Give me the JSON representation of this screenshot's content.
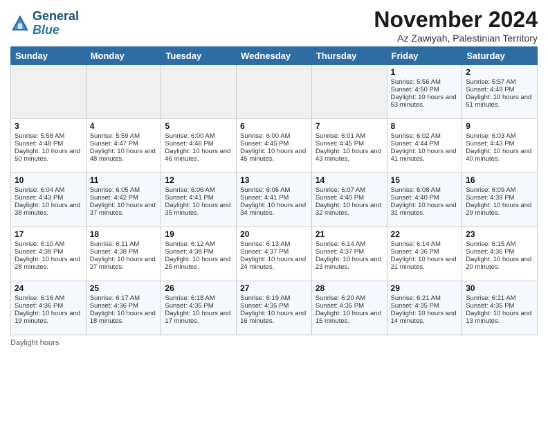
{
  "header": {
    "logo_line1": "General",
    "logo_line2": "Blue",
    "title": "November 2024",
    "subtitle": "Az Zawiyah, Palestinian Territory"
  },
  "days_of_week": [
    "Sunday",
    "Monday",
    "Tuesday",
    "Wednesday",
    "Thursday",
    "Friday",
    "Saturday"
  ],
  "weeks": [
    [
      {
        "day": "",
        "info": ""
      },
      {
        "day": "",
        "info": ""
      },
      {
        "day": "",
        "info": ""
      },
      {
        "day": "",
        "info": ""
      },
      {
        "day": "",
        "info": ""
      },
      {
        "day": "1",
        "info": "Sunrise: 5:56 AM\nSunset: 4:50 PM\nDaylight: 10 hours and 53 minutes."
      },
      {
        "day": "2",
        "info": "Sunrise: 5:57 AM\nSunset: 4:49 PM\nDaylight: 10 hours and 51 minutes."
      }
    ],
    [
      {
        "day": "3",
        "info": "Sunrise: 5:58 AM\nSunset: 4:48 PM\nDaylight: 10 hours and 50 minutes."
      },
      {
        "day": "4",
        "info": "Sunrise: 5:59 AM\nSunset: 4:47 PM\nDaylight: 10 hours and 48 minutes."
      },
      {
        "day": "5",
        "info": "Sunrise: 6:00 AM\nSunset: 4:46 PM\nDaylight: 10 hours and 46 minutes."
      },
      {
        "day": "6",
        "info": "Sunrise: 6:00 AM\nSunset: 4:45 PM\nDaylight: 10 hours and 45 minutes."
      },
      {
        "day": "7",
        "info": "Sunrise: 6:01 AM\nSunset: 4:45 PM\nDaylight: 10 hours and 43 minutes."
      },
      {
        "day": "8",
        "info": "Sunrise: 6:02 AM\nSunset: 4:44 PM\nDaylight: 10 hours and 41 minutes."
      },
      {
        "day": "9",
        "info": "Sunrise: 6:03 AM\nSunset: 4:43 PM\nDaylight: 10 hours and 40 minutes."
      }
    ],
    [
      {
        "day": "10",
        "info": "Sunrise: 6:04 AM\nSunset: 4:43 PM\nDaylight: 10 hours and 38 minutes."
      },
      {
        "day": "11",
        "info": "Sunrise: 6:05 AM\nSunset: 4:42 PM\nDaylight: 10 hours and 37 minutes."
      },
      {
        "day": "12",
        "info": "Sunrise: 6:06 AM\nSunset: 4:41 PM\nDaylight: 10 hours and 35 minutes."
      },
      {
        "day": "13",
        "info": "Sunrise: 6:06 AM\nSunset: 4:41 PM\nDaylight: 10 hours and 34 minutes."
      },
      {
        "day": "14",
        "info": "Sunrise: 6:07 AM\nSunset: 4:40 PM\nDaylight: 10 hours and 32 minutes."
      },
      {
        "day": "15",
        "info": "Sunrise: 6:08 AM\nSunset: 4:40 PM\nDaylight: 10 hours and 31 minutes."
      },
      {
        "day": "16",
        "info": "Sunrise: 6:09 AM\nSunset: 4:39 PM\nDaylight: 10 hours and 29 minutes."
      }
    ],
    [
      {
        "day": "17",
        "info": "Sunrise: 6:10 AM\nSunset: 4:38 PM\nDaylight: 10 hours and 28 minutes."
      },
      {
        "day": "18",
        "info": "Sunrise: 6:11 AM\nSunset: 4:38 PM\nDaylight: 10 hours and 27 minutes."
      },
      {
        "day": "19",
        "info": "Sunrise: 6:12 AM\nSunset: 4:38 PM\nDaylight: 10 hours and 25 minutes."
      },
      {
        "day": "20",
        "info": "Sunrise: 6:13 AM\nSunset: 4:37 PM\nDaylight: 10 hours and 24 minutes."
      },
      {
        "day": "21",
        "info": "Sunrise: 6:14 AM\nSunset: 4:37 PM\nDaylight: 10 hours and 23 minutes."
      },
      {
        "day": "22",
        "info": "Sunrise: 6:14 AM\nSunset: 4:36 PM\nDaylight: 10 hours and 21 minutes."
      },
      {
        "day": "23",
        "info": "Sunrise: 6:15 AM\nSunset: 4:36 PM\nDaylight: 10 hours and 20 minutes."
      }
    ],
    [
      {
        "day": "24",
        "info": "Sunrise: 6:16 AM\nSunset: 4:36 PM\nDaylight: 10 hours and 19 minutes."
      },
      {
        "day": "25",
        "info": "Sunrise: 6:17 AM\nSunset: 4:36 PM\nDaylight: 10 hours and 18 minutes."
      },
      {
        "day": "26",
        "info": "Sunrise: 6:18 AM\nSunset: 4:35 PM\nDaylight: 10 hours and 17 minutes."
      },
      {
        "day": "27",
        "info": "Sunrise: 6:19 AM\nSunset: 4:35 PM\nDaylight: 10 hours and 16 minutes."
      },
      {
        "day": "28",
        "info": "Sunrise: 6:20 AM\nSunset: 4:35 PM\nDaylight: 10 hours and 15 minutes."
      },
      {
        "day": "29",
        "info": "Sunrise: 6:21 AM\nSunset: 4:35 PM\nDaylight: 10 hours and 14 minutes."
      },
      {
        "day": "30",
        "info": "Sunrise: 6:21 AM\nSunset: 4:35 PM\nDaylight: 10 hours and 13 minutes."
      }
    ]
  ],
  "footer": {
    "daylight_label": "Daylight hours"
  }
}
